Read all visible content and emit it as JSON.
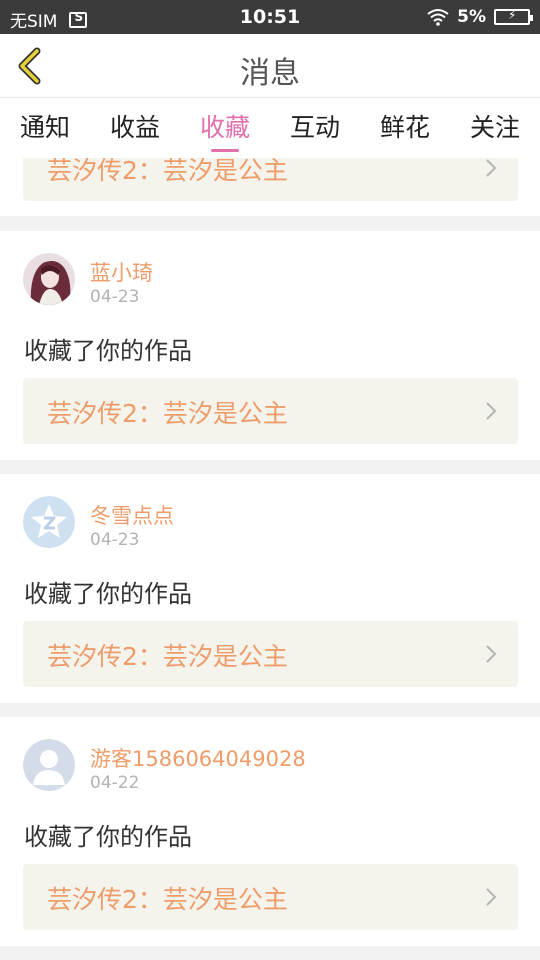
{
  "status_bar": {
    "carrier": "无SIM",
    "time": "10:51",
    "battery": "5%",
    "icons": [
      "screenshot-icon",
      "wifi-icon",
      "battery-icon"
    ]
  },
  "header": {
    "title": "消息",
    "back_icon": "chevron-left-icon"
  },
  "tabs": [
    {
      "label": "通知",
      "active": false
    },
    {
      "label": "收益",
      "active": false
    },
    {
      "label": "收藏",
      "active": true
    },
    {
      "label": "互动",
      "active": false
    },
    {
      "label": "鲜花",
      "active": false
    },
    {
      "label": "关注",
      "active": false
    }
  ],
  "accent_color": "#e270ad",
  "link_color": "#ee9c6a",
  "feed": [
    {
      "work_title": "芸汐传2：芸汐是公主"
    },
    {
      "user": "蓝小琦",
      "date": "04-23",
      "action": "收藏了你的作品",
      "work_title": "芸汐传2：芸汐是公主",
      "avatar": "anime-girl-avatar"
    },
    {
      "user": "冬雪点点",
      "date": "04-23",
      "action": "收藏了你的作品",
      "work_title": "芸汐传2：芸汐是公主",
      "avatar": "app-logo-avatar"
    },
    {
      "user": "游客1586064049028",
      "date": "04-22",
      "action": "收藏了你的作品",
      "work_title": "芸汐传2：芸汐是公主",
      "avatar": "default-user-avatar"
    }
  ]
}
